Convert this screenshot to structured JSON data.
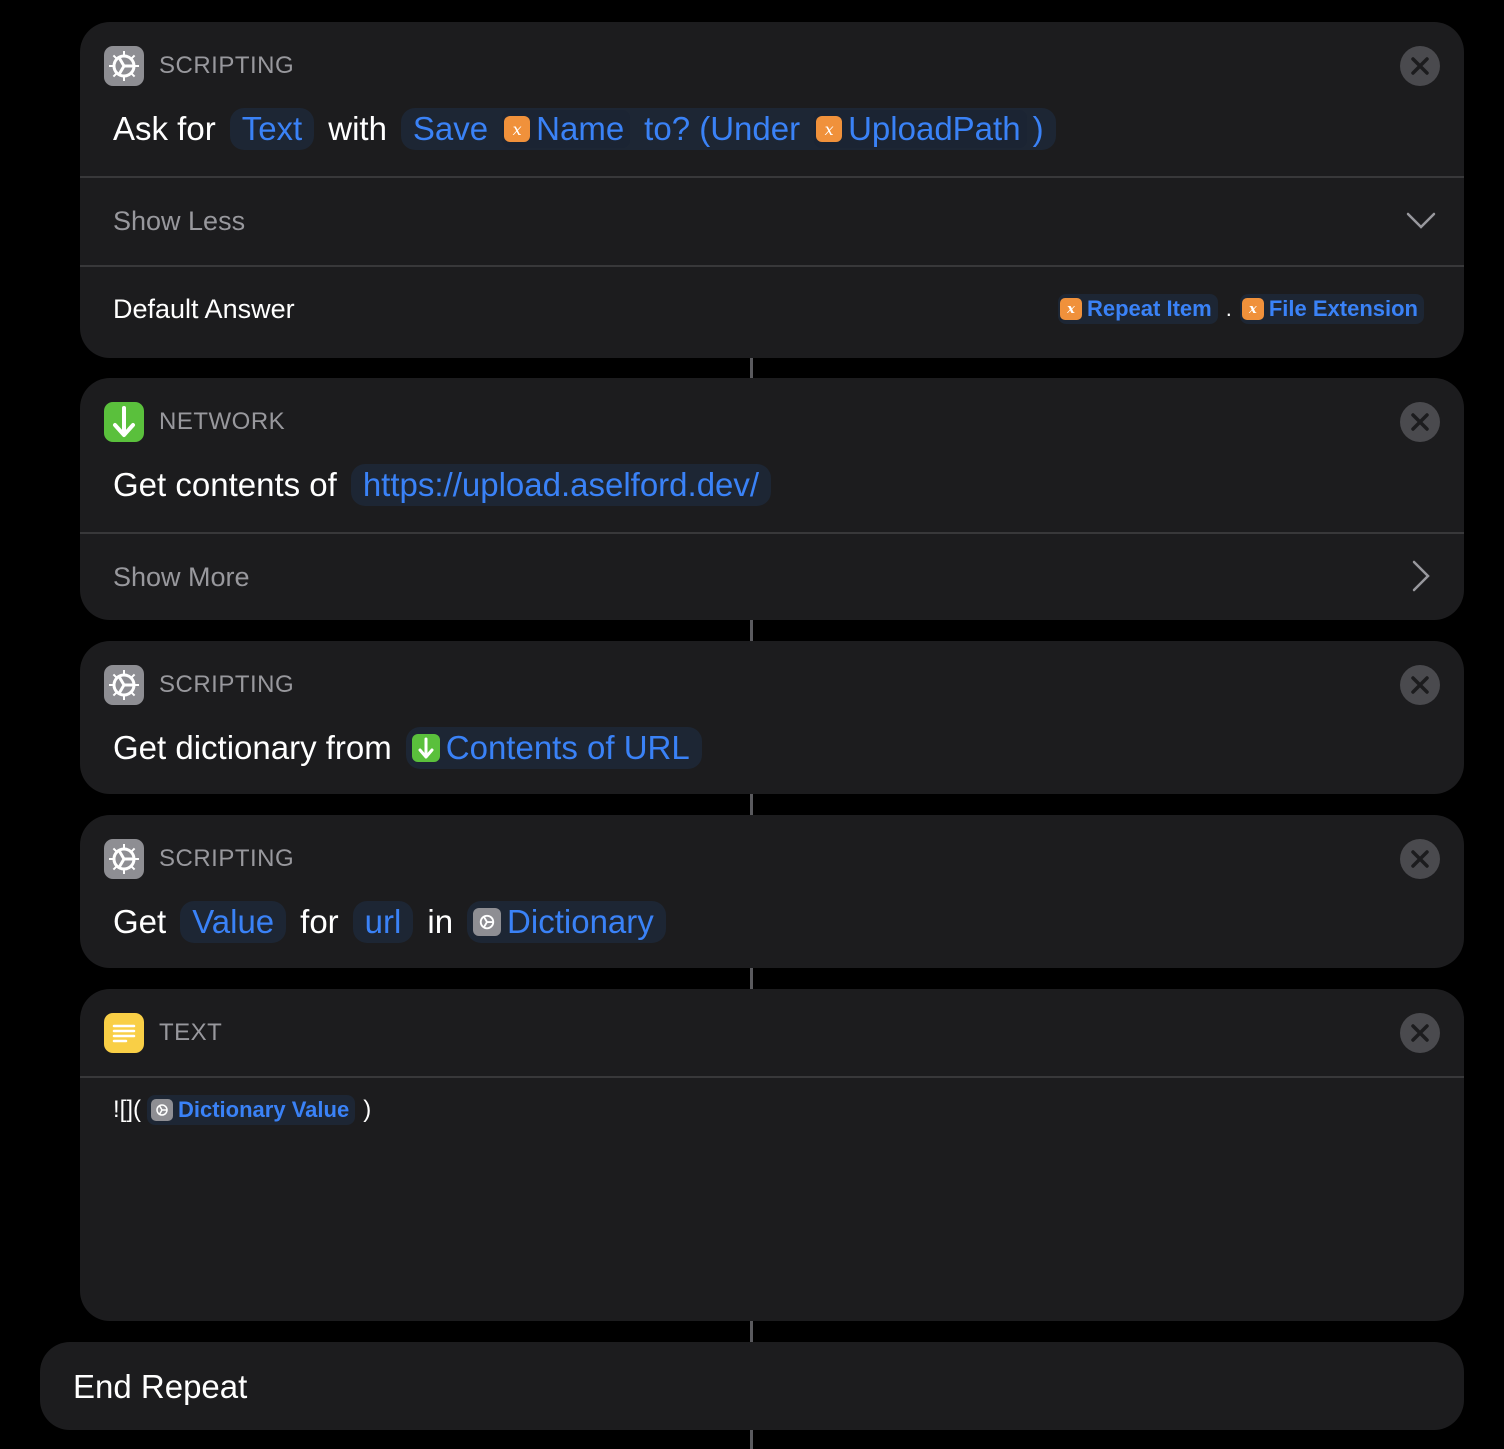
{
  "colors": {
    "background": "#000000",
    "card": "#1c1c1e",
    "token_text": "#3a82f7",
    "token_bg": "#1d2634",
    "variable_badge": "#f0913b",
    "scripting_icon": "#8e8e93",
    "network_icon": "#5ac03c",
    "text_icon": "#f9cf46"
  },
  "actions": [
    {
      "category": "SCRIPTING",
      "icon": "gear-icon",
      "line": {
        "w1": "Ask for",
        "t1": "Text",
        "w2": "with",
        "prompt_prefix": "Save",
        "var1": "Name",
        "prompt_mid": "to? (Under",
        "var2": "UploadPath",
        "prompt_suffix": ")"
      },
      "toggle_label": "Show Less",
      "param_label": "Default Answer",
      "param_var1": "Repeat Item",
      "param_sep": ".",
      "param_var2": "File Extension"
    },
    {
      "category": "NETWORK",
      "icon": "download-arrow-icon",
      "line": {
        "w1": "Get contents of",
        "t1": "https://upload.aselford.dev/"
      },
      "toggle_label": "Show More"
    },
    {
      "category": "SCRIPTING",
      "icon": "gear-icon",
      "line": {
        "w1": "Get dictionary from",
        "t1": "Contents of URL"
      }
    },
    {
      "category": "SCRIPTING",
      "icon": "gear-icon",
      "line": {
        "w1": "Get",
        "t1": "Value",
        "w2": "for",
        "t2": "url",
        "w3": "in",
        "t3": "Dictionary"
      }
    },
    {
      "category": "TEXT",
      "icon": "text-lines-icon",
      "body_prefix": "![](",
      "body_var": "Dictionary Value",
      "body_suffix": ")"
    }
  ],
  "end_block": {
    "label": "End Repeat"
  }
}
